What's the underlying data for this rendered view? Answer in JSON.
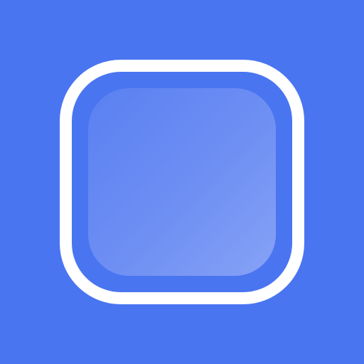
{
  "icon": {
    "name": "rounded-square-app-icon",
    "colors": {
      "background": "#4A75F1",
      "frame_stroke": "#FFFFFF",
      "inner_fill_start": "#5A80F2",
      "inner_fill_end": "#87A2F6"
    }
  }
}
